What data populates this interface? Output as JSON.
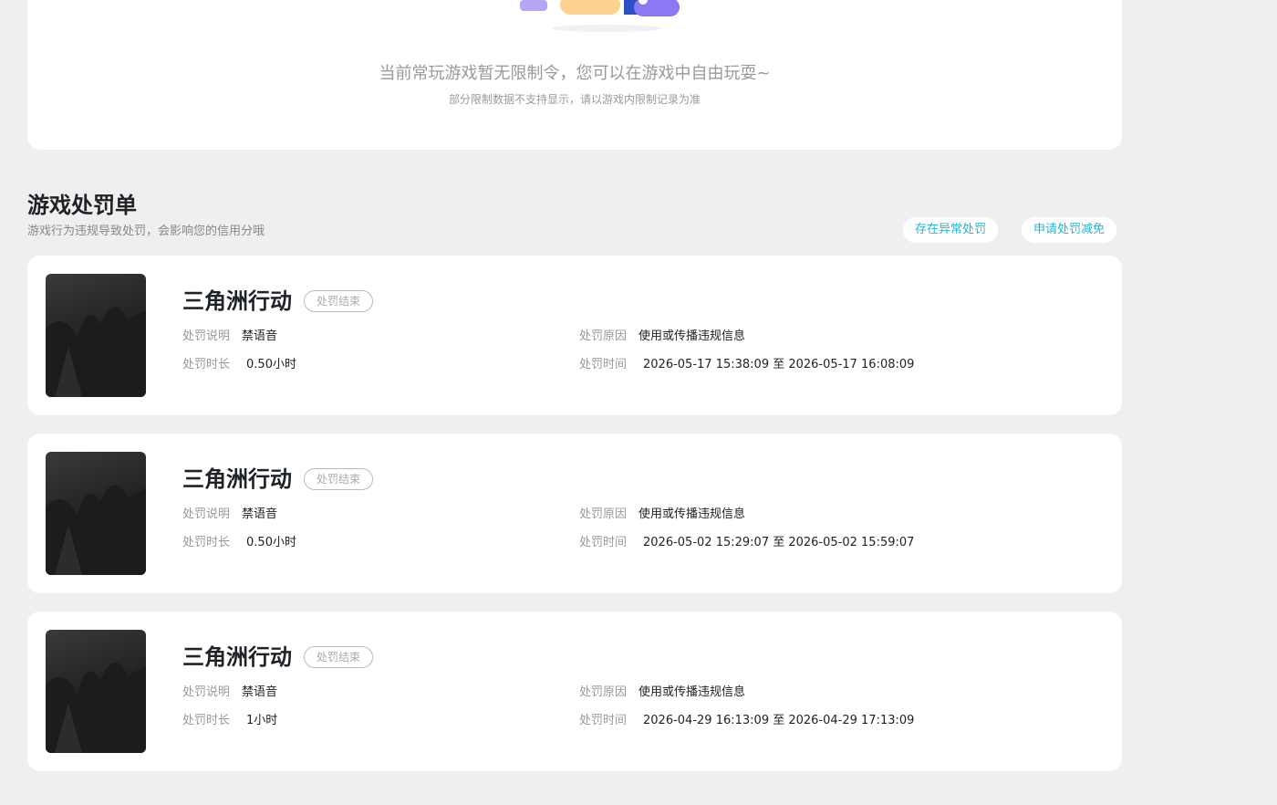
{
  "restriction": {
    "message": "当前常玩游戏暂无限制令，您可以在游戏中自由玩耍~",
    "note": "部分限制数据不支持显示，请以游戏内限制记录为准"
  },
  "penalties": {
    "title": "游戏处罚单",
    "subtitle": "游戏行为违规导致处罚，会影响您的信用分哦",
    "abnormal_button": "存在异常处罚",
    "reduce_button": "申请处罚减免",
    "labels": {
      "desc": "处罚说明",
      "duration": "处罚时长",
      "reason": "处罚原因",
      "time": "处罚时间"
    },
    "items": [
      {
        "game": "三角洲行动",
        "status": "处罚结束",
        "desc": "禁语音",
        "duration": "0.50小时",
        "reason": "使用或传播违规信息",
        "time": "2026-05-17 15:38:09 至 2026-05-17 16:08:09"
      },
      {
        "game": "三角洲行动",
        "status": "处罚结束",
        "desc": "禁语音",
        "duration": "0.50小时",
        "reason": "使用或传播违规信息",
        "time": "2026-05-02 15:29:07 至 2026-05-02 15:59:07"
      },
      {
        "game": "三角洲行动",
        "status": "处罚结束",
        "desc": "禁语音",
        "duration": "1小时",
        "reason": "使用或传播违规信息",
        "time": "2026-04-29 16:13:09 至 2026-04-29 17:13:09"
      }
    ]
  },
  "colors": {
    "accent": "#27b3cf",
    "background": "#efefef",
    "card": "#ffffff"
  },
  "icons": {
    "illustration": "empty-state-illustration-icon",
    "cover": "game-cover-image"
  }
}
